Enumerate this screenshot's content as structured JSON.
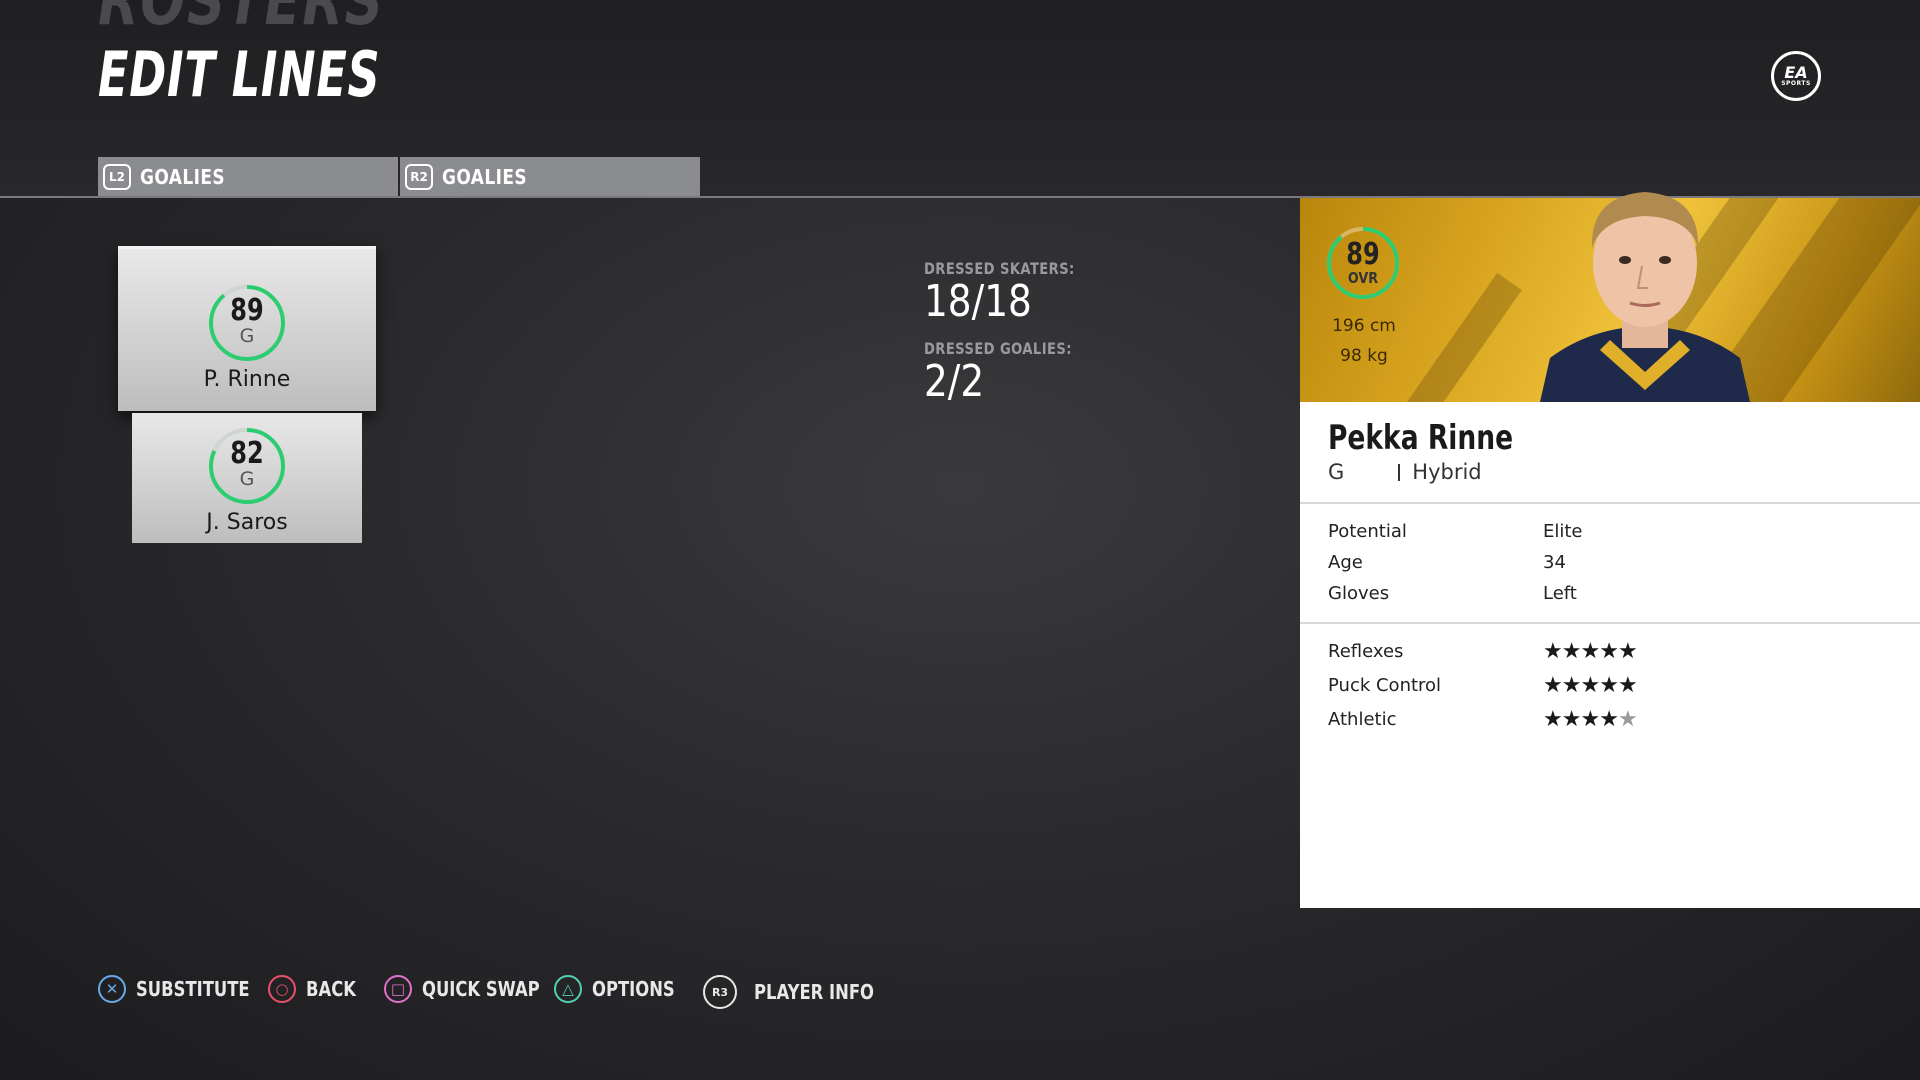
{
  "header": {
    "section_ghost": "ROSTERS",
    "title": "EDIT LINES",
    "logo": {
      "top": "EA",
      "bottom": "SPORTS"
    }
  },
  "tabs": [
    {
      "button": "L2",
      "label": "GOALIES"
    },
    {
      "button": "R2",
      "label": "GOALIES"
    }
  ],
  "goalies": [
    {
      "ovr": "89",
      "pos": "G",
      "name": "P. Rinne",
      "selected": true
    },
    {
      "ovr": "82",
      "pos": "G",
      "name": "J. Saros",
      "selected": false
    }
  ],
  "dressed": {
    "skaters_label": "DRESSED SKATERS:",
    "skaters_value": "18/18",
    "goalies_label": "DRESSED GOALIES:",
    "goalies_value": "2/2"
  },
  "player": {
    "ovr": "89",
    "ovr_label": "OVR",
    "height": "196 cm",
    "weight": "98 kg",
    "full_name": "Pekka Rinne",
    "position": "G",
    "style": "Hybrid",
    "info": [
      {
        "label": "Potential",
        "value": "Elite"
      },
      {
        "label": "Age",
        "value": "34"
      },
      {
        "label": "Gloves",
        "value": "Left"
      }
    ],
    "ratings": [
      {
        "label": "Reflexes",
        "stars": 5
      },
      {
        "label": "Puck Control",
        "stars": 5
      },
      {
        "label": "Athletic",
        "stars": 4.5
      }
    ]
  },
  "footer": [
    {
      "icon": "cross-button-icon",
      "glyph": "✕",
      "color": "#6aa8e8",
      "label": "SUBSTITUTE"
    },
    {
      "icon": "circle-button-icon",
      "glyph": "○",
      "color": "#e8506a",
      "label": "BACK"
    },
    {
      "icon": "square-button-icon",
      "glyph": "□",
      "color": "#e070c8",
      "label": "QUICK SWAP"
    },
    {
      "icon": "triangle-button-icon",
      "glyph": "△",
      "color": "#50d0b0",
      "label": "OPTIONS"
    },
    {
      "icon": "r3-button-icon",
      "glyph": "R3",
      "color": "#e8e8e8",
      "label": "PLAYER INFO"
    }
  ],
  "colors": {
    "ring_accent": "#2ecc71",
    "banner_gold": "#e0b02a",
    "tab_bg": "#8a8c90"
  }
}
